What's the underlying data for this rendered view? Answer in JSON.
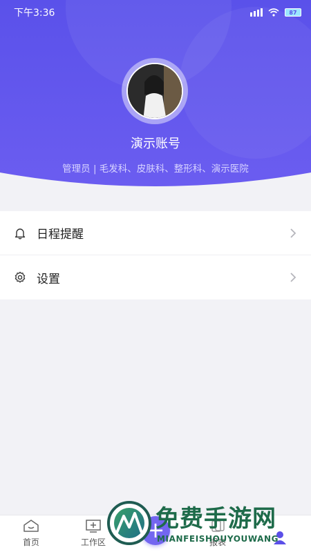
{
  "status_bar": {
    "time": "下午3:36",
    "battery": "87"
  },
  "profile": {
    "name": "演示账号",
    "description": "管理员 | 毛发科、皮肤科、整形科、演示医院"
  },
  "menu": [
    {
      "label": "日程提醒",
      "icon": "bell-icon"
    },
    {
      "label": "设置",
      "icon": "gear-icon"
    }
  ],
  "tabs": [
    {
      "label": "首页",
      "icon": "home-icon"
    },
    {
      "label": "工作区",
      "icon": "workspace-icon"
    },
    {
      "label": "",
      "icon": "plus-icon"
    },
    {
      "label": "报表",
      "icon": "report-icon"
    },
    {
      "label": "",
      "icon": "profile-icon"
    }
  ],
  "watermark": {
    "title": "免费手游网",
    "subtitle": "MIANFEISHOUYOUWANG"
  },
  "colors": {
    "header_top": "#5b52ea",
    "header_bottom": "#6d5ff0",
    "accent": "#5b4fe8"
  }
}
